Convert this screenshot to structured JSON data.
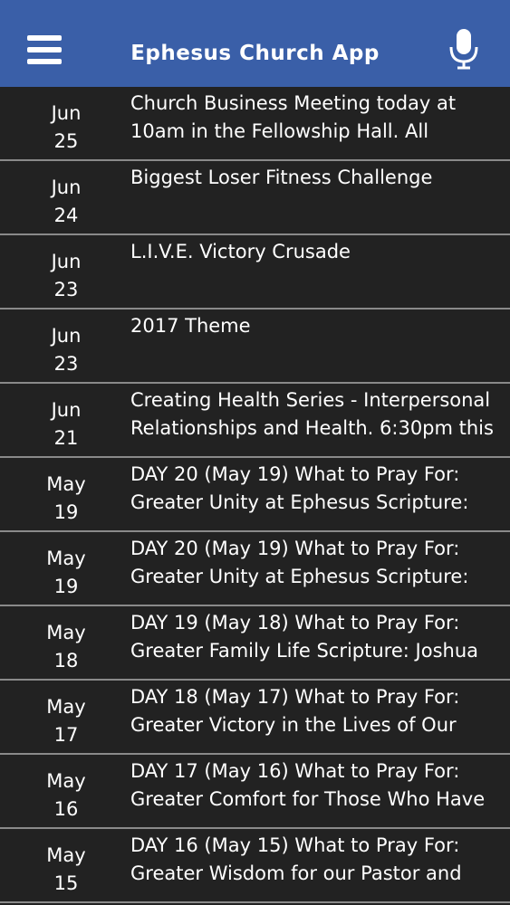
{
  "header": {
    "title": "Ephesus Church App",
    "menu_icon": "hamburger-menu-icon",
    "mic_icon": "microphone-icon",
    "background": "#3a5fa8"
  },
  "items": [
    {
      "month": "Jun",
      "day": "25",
      "line1": "Church Business Meeting today at",
      "line2": "10am in the Fellowship Hall. All"
    },
    {
      "month": "Jun",
      "day": "24",
      "line1": "Biggest Loser Fitness Challenge",
      "line2": ""
    },
    {
      "month": "Jun",
      "day": "23",
      "line1": "L.I.V.E. Victory Crusade",
      "line2": ""
    },
    {
      "month": "Jun",
      "day": "23",
      "line1": "2017 Theme",
      "line2": ""
    },
    {
      "month": "Jun",
      "day": "21",
      "line1": "Creating Health Series - Interpersonal",
      "line2": "Relationships and Health. 6:30pm this"
    },
    {
      "month": "May",
      "day": "19",
      "line1": "DAY 20 (May 19) What to Pray For:",
      "line2": "Greater Unity at Ephesus Scripture:"
    },
    {
      "month": "May",
      "day": "19",
      "line1": "DAY 20 (May 19) What to Pray For:",
      "line2": "Greater Unity at Ephesus Scripture:"
    },
    {
      "month": "May",
      "day": "18",
      "line1": "DAY 19 (May 18) What to Pray For:",
      "line2": "Greater Family Life Scripture: Joshua"
    },
    {
      "month": "May",
      "day": "17",
      "line1": "DAY 18 (May 17) What to Pray For:",
      "line2": "Greater Victory in the Lives of Our"
    },
    {
      "month": "May",
      "day": "16",
      "line1": "DAY 17 (May 16) What to Pray For:",
      "line2": "Greater Comfort for Those Who Have"
    },
    {
      "month": "May",
      "day": "15",
      "line1": "DAY 16 (May 15) What to Pray For:",
      "line2": "Greater Wisdom for our Pastor and"
    }
  ]
}
